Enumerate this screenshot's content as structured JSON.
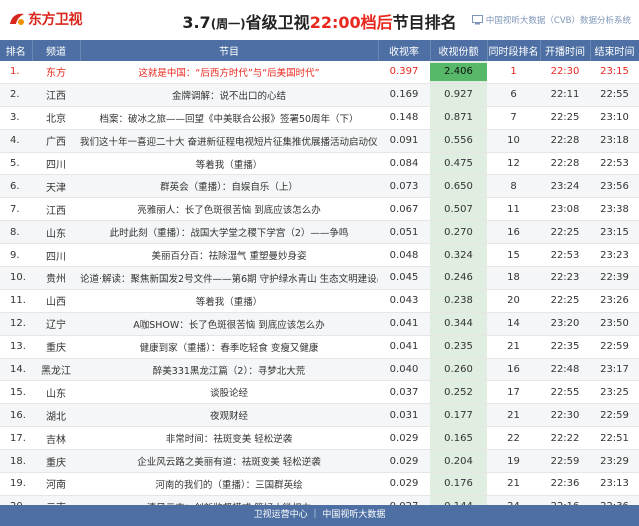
{
  "header": {
    "logo_text": "东方卫视",
    "title_date": "3.7",
    "title_weekday": "(周一)",
    "title_mid": "省级卫视",
    "title_accent": "22:00档后",
    "title_end": "节目排名",
    "brand_text": "中国视听大数据（CVB）数据分析系统"
  },
  "columns": [
    "排名",
    "频道",
    "节目",
    "收视率",
    "收视份额",
    "同时段排名",
    "开播时间",
    "结束时间"
  ],
  "rows": [
    {
      "rank": "1.",
      "channel": "东方",
      "program": "这就是中国：“后西方时代”与“后美国时代”",
      "rating": "0.397",
      "share": "2.406",
      "slot_rank": "1",
      "start": "22:30",
      "end": "23:15"
    },
    {
      "rank": "2.",
      "channel": "江西",
      "program": "金牌调解：说不出口的心结",
      "rating": "0.169",
      "share": "0.927",
      "slot_rank": "6",
      "start": "22:11",
      "end": "22:55"
    },
    {
      "rank": "3.",
      "channel": "北京",
      "program": "档案：破冰之旅——回望《中美联合公报》签署50周年（下）",
      "rating": "0.148",
      "share": "0.871",
      "slot_rank": "7",
      "start": "22:25",
      "end": "23:10"
    },
    {
      "rank": "4.",
      "channel": "广西",
      "program": "我们这十年一喜迎二十大 奋进新征程电视短片征集推优展播活动启动仪式（重播）",
      "rating": "0.091",
      "share": "0.556",
      "slot_rank": "10",
      "start": "22:28",
      "end": "23:18"
    },
    {
      "rank": "5.",
      "channel": "四川",
      "program": "等着我（重播）",
      "rating": "0.084",
      "share": "0.475",
      "slot_rank": "12",
      "start": "22:28",
      "end": "22:53"
    },
    {
      "rank": "6.",
      "channel": "天津",
      "program": "群英会（重播）：自娱自乐（上）",
      "rating": "0.073",
      "share": "0.650",
      "slot_rank": "8",
      "start": "23:24",
      "end": "23:56"
    },
    {
      "rank": "7.",
      "channel": "江西",
      "program": "亮雅丽人：长了色斑很苦恼 到底应该怎么办",
      "rating": "0.067",
      "share": "0.507",
      "slot_rank": "11",
      "start": "23:08",
      "end": "23:38"
    },
    {
      "rank": "8.",
      "channel": "山东",
      "program": "此时此刻（重播）：战国大学堂之稷下学宫（2）——争鸣",
      "rating": "0.051",
      "share": "0.270",
      "slot_rank": "16",
      "start": "22:25",
      "end": "23:15"
    },
    {
      "rank": "9.",
      "channel": "四川",
      "program": "美丽百分百：祛除湿气 重塑曼妙身姿",
      "rating": "0.048",
      "share": "0.324",
      "slot_rank": "15",
      "start": "22:53",
      "end": "23:23"
    },
    {
      "rank": "10.",
      "channel": "贵州",
      "program": "论道·解读：聚焦新国发2号文件——第6期 守护绿水青山 生态文明建设出新绩",
      "rating": "0.045",
      "share": "0.246",
      "slot_rank": "18",
      "start": "22:23",
      "end": "22:39"
    },
    {
      "rank": "11.",
      "channel": "山西",
      "program": "等着我（重播）",
      "rating": "0.043",
      "share": "0.238",
      "slot_rank": "20",
      "start": "22:25",
      "end": "23:26"
    },
    {
      "rank": "12.",
      "channel": "辽宁",
      "program": "A咖SHOW：长了色斑很苦恼 到底应该怎么办",
      "rating": "0.041",
      "share": "0.344",
      "slot_rank": "14",
      "start": "23:20",
      "end": "23:50"
    },
    {
      "rank": "13.",
      "channel": "重庆",
      "program": "健康到家（重播）：春季吃轻食 变瘦又健康",
      "rating": "0.041",
      "share": "0.235",
      "slot_rank": "21",
      "start": "22:35",
      "end": "22:59"
    },
    {
      "rank": "14.",
      "channel": "黑龙江",
      "program": "醉美331黑龙江篇（2）：寻梦北大荒",
      "rating": "0.040",
      "share": "0.260",
      "slot_rank": "16",
      "start": "22:48",
      "end": "23:17"
    },
    {
      "rank": "15.",
      "channel": "山东",
      "program": "谈股论经",
      "rating": "0.037",
      "share": "0.252",
      "slot_rank": "17",
      "start": "22:55",
      "end": "23:25"
    },
    {
      "rank": "16.",
      "channel": "湖北",
      "program": "夜观财经",
      "rating": "0.031",
      "share": "0.177",
      "slot_rank": "21",
      "start": "22:30",
      "end": "22:59"
    },
    {
      "rank": "17.",
      "channel": "吉林",
      "program": "非常时间：祛斑变美 轻松逆袭",
      "rating": "0.029",
      "share": "0.165",
      "slot_rank": "22",
      "start": "22:22",
      "end": "22:51"
    },
    {
      "rank": "18.",
      "channel": "重庆",
      "program": "企业风云路之美丽有道：祛斑变美 轻松逆袭",
      "rating": "0.029",
      "share": "0.204",
      "slot_rank": "19",
      "start": "22:59",
      "end": "23:29"
    },
    {
      "rank": "19.",
      "channel": "河南",
      "program": "河南的我们的（重播）：三国群英绘",
      "rating": "0.029",
      "share": "0.176",
      "slot_rank": "21",
      "start": "22:36",
      "end": "23:13"
    },
    {
      "rank": "20.",
      "channel": "云南",
      "program": "清风云南：创新监督模式 管好小微权力",
      "rating": "0.027",
      "share": "0.144",
      "slot_rank": "24",
      "start": "22:16",
      "end": "22:36"
    }
  ],
  "share_max": 2.406,
  "footer": "卫视运营中心 ｜ 中国视听大数据",
  "colors": {
    "header_bg": "#4d6fa3",
    "accent": "#e8281e",
    "bar": "#3fae55"
  }
}
